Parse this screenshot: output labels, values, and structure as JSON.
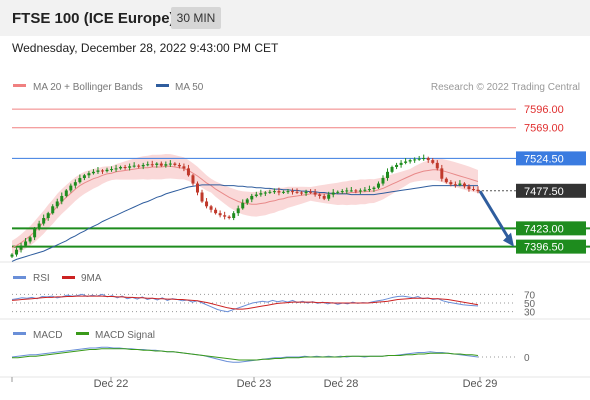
{
  "header": {
    "title": "FTSE 100 (ICE Europe)",
    "timeframe": "30 MIN",
    "datetime": "Wednesday, December 28, 2022 9:43:00 PM CET"
  },
  "colors": {
    "resistance": "#f08080",
    "ma50": "#2f5d9e",
    "support": "#1e8c1e",
    "current": "#333333",
    "blueLevel": "#3a7be0",
    "arrow": "#2f5d9e",
    "band": "#f8c9c9",
    "up": "#1e8c1e",
    "down": "#c0392b"
  },
  "chart_data": {
    "main": {
      "type": "candlestick",
      "instrument": "FTSE 100 (ICE Europe)",
      "legend": [
        "MA 20 + Bollinger Bands",
        "MA 50"
      ],
      "credit": "Research © 2022 Trading Central",
      "ylim": [
        7380,
        7615
      ],
      "levels": [
        {
          "value": 7596.0,
          "label": "7596.00",
          "kind": "resistance"
        },
        {
          "value": 7569.0,
          "label": "7569.00",
          "kind": "resistance"
        },
        {
          "value": 7524.5,
          "label": "7524.50",
          "kind": "pivot"
        },
        {
          "value": 7477.5,
          "label": "7477.50",
          "kind": "current"
        },
        {
          "value": 7423.0,
          "label": "7423.00",
          "kind": "support"
        },
        {
          "value": 7396.5,
          "label": "7396.50",
          "kind": "support"
        }
      ],
      "forecast_arrow": {
        "direction": "down",
        "target": 7396.5
      },
      "closes": [
        7385,
        7392,
        7398,
        7404,
        7410,
        7422,
        7430,
        7438,
        7445,
        7455,
        7462,
        7470,
        7478,
        7485,
        7490,
        7496,
        7500,
        7503,
        7505,
        7507,
        7506,
        7508,
        7509,
        7510,
        7512,
        7511,
        7513,
        7514,
        7513,
        7515,
        7516,
        7515,
        7517,
        7514,
        7516,
        7517,
        7515,
        7513,
        7510,
        7500,
        7488,
        7475,
        7462,
        7455,
        7450,
        7445,
        7442,
        7440,
        7438,
        7445,
        7452,
        7460,
        7465,
        7470,
        7472,
        7474,
        7475,
        7476,
        7477,
        7475,
        7476,
        7477,
        7476,
        7475,
        7474,
        7476,
        7475,
        7472,
        7470,
        7466,
        7472,
        7475,
        7476,
        7477,
        7478,
        7478,
        7477,
        7478,
        7479,
        7480,
        7482,
        7488,
        7496,
        7505,
        7512,
        7515,
        7518,
        7520,
        7522,
        7523,
        7524,
        7525,
        7522,
        7518,
        7510,
        7495,
        7490,
        7487,
        7486,
        7488,
        7484,
        7480,
        7479,
        7477
      ],
      "ma20": [
        7395,
        7398,
        7402,
        7407,
        7412,
        7418,
        7425,
        7432,
        7440,
        7447,
        7455,
        7462,
        7468,
        7474,
        7480,
        7485,
        7489,
        7492,
        7495,
        7497,
        7500,
        7502,
        7503,
        7505,
        7506,
        7507,
        7508,
        7509,
        7510,
        7511,
        7511,
        7512,
        7512,
        7512,
        7513,
        7513,
        7512,
        7511,
        7510,
        7507,
        7503,
        7499,
        7494,
        7489,
        7485,
        7480,
        7476,
        7472,
        7468,
        7465,
        7462,
        7460,
        7459,
        7458,
        7458,
        7459,
        7460,
        7462,
        7463,
        7465,
        7466,
        7468,
        7469,
        7470,
        7471,
        7472,
        7473,
        7473,
        7473,
        7473,
        7473,
        7473,
        7473,
        7474,
        7474,
        7475,
        7475,
        7476,
        7476,
        7477,
        7477,
        7479,
        7481,
        7484,
        7487,
        7490,
        7493,
        7496,
        7499,
        7502,
        7504,
        7506,
        7507,
        7508,
        7508,
        7507,
        7505,
        7503,
        7501,
        7499,
        7497,
        7495,
        7493,
        7491
      ],
      "ma50": [
        7375,
        7378,
        7380,
        7382,
        7384,
        7386,
        7388,
        7390,
        7393,
        7396,
        7399,
        7402,
        7405,
        7409,
        7412,
        7416,
        7419,
        7423,
        7426,
        7429,
        7433,
        7436,
        7439,
        7442,
        7445,
        7448,
        7451,
        7454,
        7457,
        7460,
        7462,
        7465,
        7468,
        7470,
        7473,
        7475,
        7477,
        7479,
        7481,
        7483,
        7484,
        7485,
        7486,
        7486,
        7486,
        7486,
        7486,
        7485,
        7485,
        7485,
        7484,
        7484,
        7483,
        7483,
        7482,
        7482,
        7481,
        7481,
        7480,
        7480,
        7479,
        7479,
        7478,
        7478,
        7477,
        7477,
        7476,
        7476,
        7475,
        7475,
        7474,
        7474,
        7473,
        7473,
        7473,
        7472,
        7472,
        7472,
        7472,
        7472,
        7472,
        7473,
        7474,
        7475,
        7476,
        7477,
        7478,
        7479,
        7480,
        7481,
        7482,
        7483,
        7484,
        7485,
        7485,
        7485,
        7485,
        7485,
        7485,
        7485,
        7485,
        7485,
        7485,
        7485
      ]
    },
    "rsi": {
      "type": "line",
      "legend": [
        "RSI",
        "9MA"
      ],
      "ticks": [
        "70",
        "50",
        "30"
      ],
      "ylim": [
        20,
        80
      ],
      "rsi": [
        58,
        60,
        62,
        61,
        63,
        60,
        65,
        64,
        66,
        62,
        64,
        68,
        66,
        67,
        70,
        65,
        68,
        66,
        70,
        64,
        67,
        62,
        66,
        60,
        63,
        59,
        64,
        58,
        61,
        57,
        62,
        56,
        60,
        58,
        55,
        57,
        52,
        55,
        50,
        45,
        40,
        35,
        32,
        30,
        34,
        38,
        42,
        46,
        50,
        52,
        54,
        52,
        56,
        53,
        55,
        52,
        56,
        51,
        54,
        50,
        53,
        49,
        52,
        48,
        51,
        47,
        50,
        48,
        52,
        49,
        51,
        50,
        53,
        55,
        57,
        60,
        63,
        65,
        66,
        64,
        62,
        65,
        60,
        62,
        58,
        60,
        55,
        52,
        50,
        48,
        46,
        45,
        44,
        43
      ],
      "ma9": [
        56,
        57,
        58,
        59,
        60,
        61,
        62,
        63,
        63,
        64,
        64,
        65,
        65,
        66,
        66,
        66,
        66,
        66,
        66,
        65,
        65,
        64,
        64,
        63,
        63,
        62,
        62,
        61,
        61,
        60,
        60,
        59,
        59,
        58,
        58,
        57,
        56,
        55,
        53,
        51,
        48,
        45,
        42,
        39,
        37,
        36,
        36,
        37,
        39,
        41,
        43,
        45,
        47,
        49,
        50,
        51,
        52,
        52,
        52,
        52,
        52,
        51,
        51,
        51,
        50,
        50,
        50,
        50,
        50,
        50,
        50,
        50,
        51,
        52,
        53,
        54,
        56,
        58,
        59,
        60,
        61,
        61,
        61,
        61,
        60,
        60,
        59,
        58,
        56,
        54,
        52,
        50,
        48,
        46
      ]
    },
    "macd": {
      "type": "line",
      "legend": [
        "MACD",
        "MACD Signal"
      ],
      "ticks": [
        "0"
      ],
      "ylim": [
        -20,
        20
      ],
      "macd": [
        0,
        1,
        2,
        3,
        3,
        4,
        5,
        6,
        7,
        8,
        9,
        10,
        11,
        12,
        12,
        13,
        13,
        12,
        12,
        11,
        11,
        10,
        10,
        9,
        9,
        8,
        7,
        7,
        6,
        5,
        4,
        3,
        2,
        0,
        -2,
        -4,
        -6,
        -7,
        -7,
        -6,
        -5,
        -4,
        -3,
        -2,
        -1,
        -1,
        0,
        0,
        0,
        1,
        0,
        1,
        0,
        1,
        0,
        1,
        0,
        1,
        1,
        0,
        1,
        1,
        1,
        2,
        2,
        3,
        4,
        5,
        6,
        6,
        7,
        6,
        6,
        5,
        4,
        3,
        2,
        1,
        0
      ],
      "signal": [
        -1,
        -1,
        0,
        1,
        1,
        2,
        3,
        4,
        5,
        6,
        7,
        8,
        9,
        10,
        10,
        11,
        11,
        11,
        11,
        11,
        10,
        10,
        9,
        9,
        8,
        8,
        7,
        7,
        6,
        5,
        4,
        3,
        2,
        1,
        0,
        -1,
        -2,
        -3,
        -4,
        -4,
        -4,
        -4,
        -3,
        -3,
        -2,
        -2,
        -1,
        -1,
        -1,
        0,
        0,
        0,
        0,
        0,
        0,
        0,
        1,
        1,
        1,
        1,
        1,
        1,
        1,
        2,
        2,
        2,
        3,
        3,
        4,
        4,
        5,
        5,
        5,
        5,
        4,
        4,
        3,
        3,
        2
      ]
    },
    "x_labels": [
      "Dec 22",
      "Dec 23",
      "Dec 28",
      "Dec 29"
    ]
  }
}
